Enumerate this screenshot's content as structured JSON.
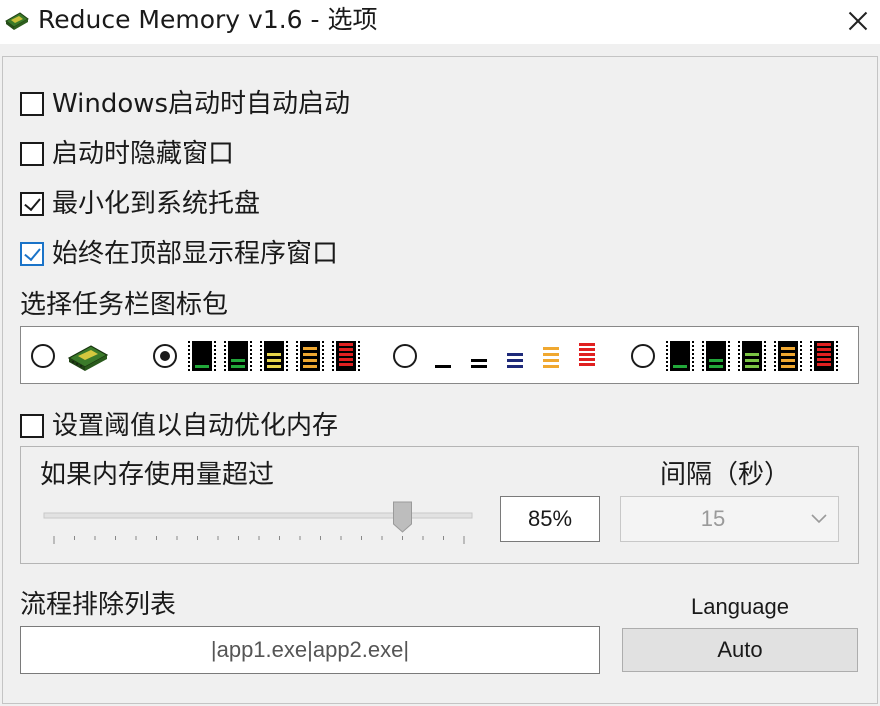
{
  "window": {
    "title": "Reduce Memory v1.6 - 选项",
    "icon": "ram-chip-icon"
  },
  "options": [
    {
      "label": "Windows启动时自动启动",
      "checked": false
    },
    {
      "label": "启动时隐藏窗口",
      "checked": false
    },
    {
      "label": "最小化到系统托盘",
      "checked": true
    },
    {
      "label": "始终在顶部显示程序窗口",
      "checked": true
    }
  ],
  "iconpack": {
    "label": "选择任务栏图标包",
    "selected_index": 1,
    "packs": [
      "ram-chip-icon-pack",
      "black-bars-icon-pack",
      "minimal-lines-icon-pack",
      "dark-bars-icon-pack"
    ]
  },
  "threshold": {
    "label": "设置阈值以自动优化内存",
    "checked": false,
    "usage_label": "如果内存使用量超过",
    "percent_text": "85%",
    "percent_value": 85,
    "interval_label": "间隔（秒）",
    "interval_value": "15"
  },
  "exclusion": {
    "label": "流程排除列表",
    "value": "|app1.exe|app2.exe|"
  },
  "language": {
    "label": "Language",
    "button": "Auto"
  },
  "colors": {
    "green": "#22a83a",
    "light_green": "#7cc544",
    "yellow": "#e8d54a",
    "orange": "#f0a830",
    "red": "#e02020",
    "navy": "#1e2a7a",
    "checkbox_blue": "#1a73c8"
  }
}
